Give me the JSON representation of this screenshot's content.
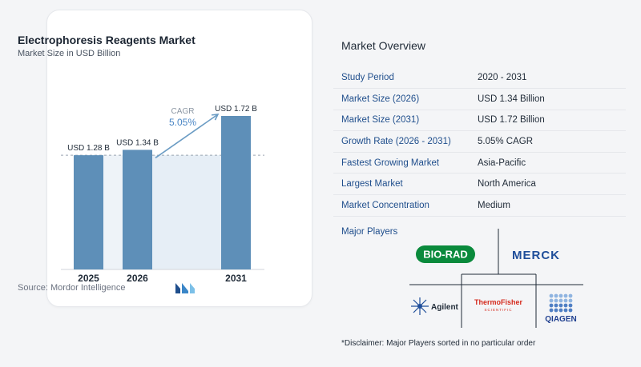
{
  "chart_data": {
    "type": "bar",
    "title": "Electrophoresis Reagents Market",
    "subtitle": "Market Size in USD Billion",
    "categories": [
      "2025",
      "2026",
      "2031"
    ],
    "values": [
      1.28,
      1.34,
      1.72
    ],
    "value_labels": [
      "USD 1.28 B",
      "USD 1.34 B",
      "USD 1.72 B"
    ],
    "cagr_label": "CAGR",
    "cagr_value": "5.05%",
    "colors": {
      "bar": "#5e8fb8",
      "arrow": "#6b9cc4",
      "shade": "#e6eef6",
      "dashed": "#9aa5b1"
    }
  },
  "source": "Source:  Mordor Intelligence",
  "overview": {
    "title": "Market Overview",
    "rows": [
      {
        "key": "Study Period",
        "value": "2020 - 2031"
      },
      {
        "key": "Market Size (2026)",
        "value": "USD 1.34 Billion"
      },
      {
        "key": "Market Size (2031)",
        "value": "USD 1.72 Billion"
      },
      {
        "key": "Growth Rate (2026 - 2031)",
        "value": "5.05% CAGR"
      },
      {
        "key": "Fastest Growing Market",
        "value": "Asia-Pacific"
      },
      {
        "key": "Largest Market",
        "value": "North America"
      },
      {
        "key": "Market Concentration",
        "value": "Medium"
      }
    ]
  },
  "players": {
    "title": "Major Players",
    "bio_rad": "BIO-RAD",
    "merck": "MERCK",
    "agilent": "Agilent",
    "thermo_line1": "ThermoFisher",
    "thermo_line2": "SCIENTIFIC",
    "qiagen": "QIAGEN",
    "colors": {
      "bio_rad": "#0a8a3c",
      "merck": "#1f4e9a",
      "thermo": "#d52b1e",
      "qiagen": "#1f3f8f"
    }
  },
  "disclaimer": "*Disclaimer: Major Players sorted in no particular order"
}
